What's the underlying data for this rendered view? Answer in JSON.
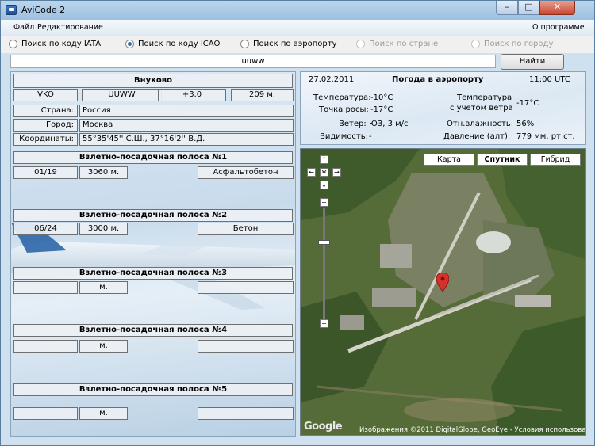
{
  "window": {
    "title": "AviCode 2",
    "min": "–",
    "max": "□",
    "close": "✕"
  },
  "menu": {
    "file": "Файл",
    "edit": "Редактирование",
    "about": "О программе"
  },
  "search_modes": [
    {
      "label": "Поиск по коду IATA",
      "checked": false,
      "enabled": true
    },
    {
      "label": "Поиск по коду ICAO",
      "checked": true,
      "enabled": true
    },
    {
      "label": "Поиск по аэропорту",
      "checked": false,
      "enabled": true
    },
    {
      "label": "Поиск по стране",
      "checked": false,
      "enabled": false
    },
    {
      "label": "Поиск по городу",
      "checked": false,
      "enabled": false
    }
  ],
  "search": {
    "value": "uuww",
    "button": "Найти"
  },
  "airport": {
    "name": "Внуково",
    "iata": "VKO",
    "icao": "UUWW",
    "utc_offset": "+3.0",
    "elevation": "209 м.",
    "country_label": "Страна:",
    "country": "Россия",
    "city_label": "Город:",
    "city": "Москва",
    "coords_label": "Координаты:",
    "coords": "55°35'45'' С.Ш., 37°16'2'' В.Д."
  },
  "runways": [
    {
      "title": "Взлетно-посадочная полоса №1",
      "heading": "01/19",
      "length": "3060 м.",
      "surface": "Асфальтобетон"
    },
    {
      "title": "Взлетно-посадочная полоса №2",
      "heading": "06/24",
      "length": "3000 м.",
      "surface": "Бетон"
    },
    {
      "title": "Взлетно-посадочная полоса №3",
      "heading": "",
      "length": "м.",
      "surface": ""
    },
    {
      "title": "Взлетно-посадочная полоса №4",
      "heading": "",
      "length": "м.",
      "surface": ""
    },
    {
      "title": "Взлетно-посадочная полоса №5",
      "heading": "",
      "length": "м.",
      "surface": ""
    }
  ],
  "weather": {
    "date": "27.02.2011",
    "title": "Погода в аэропорту",
    "time": "11:00 UTC",
    "temp_label": "Температура:",
    "temp": "-10°C",
    "dew_label": "Точка росы:",
    "dew": "-17°C",
    "wind_label": "Ветер:",
    "wind": "ЮЗ, 3 м/с",
    "vis_label": "Видимость:",
    "vis": "-",
    "feels_label_1": "Температура",
    "feels_label_2": "с учетом ветра",
    "feels": "-17°C",
    "humidity_label": "Отн.влажность:",
    "humidity": "56%",
    "pressure_label": "Давление (алт):",
    "pressure": "779 мм. рт.ст."
  },
  "map": {
    "types": [
      "Карта",
      "Спутник",
      "Гибрид"
    ],
    "selected_type": "Спутник",
    "zoom_in": "+",
    "zoom_out": "−",
    "nav_up": "↑",
    "nav_down": "↓",
    "nav_left": "←",
    "nav_right": "→",
    "nav_center": "✲",
    "google": "Google",
    "copyright": "Изображения ©2011 DigitalGlobe, GeoEye - ",
    "terms": "Условия использования"
  },
  "colors": {
    "titlebar": "#9cbfe0",
    "marker": "#d9302a",
    "radio_checked": "#2b6ab5"
  }
}
